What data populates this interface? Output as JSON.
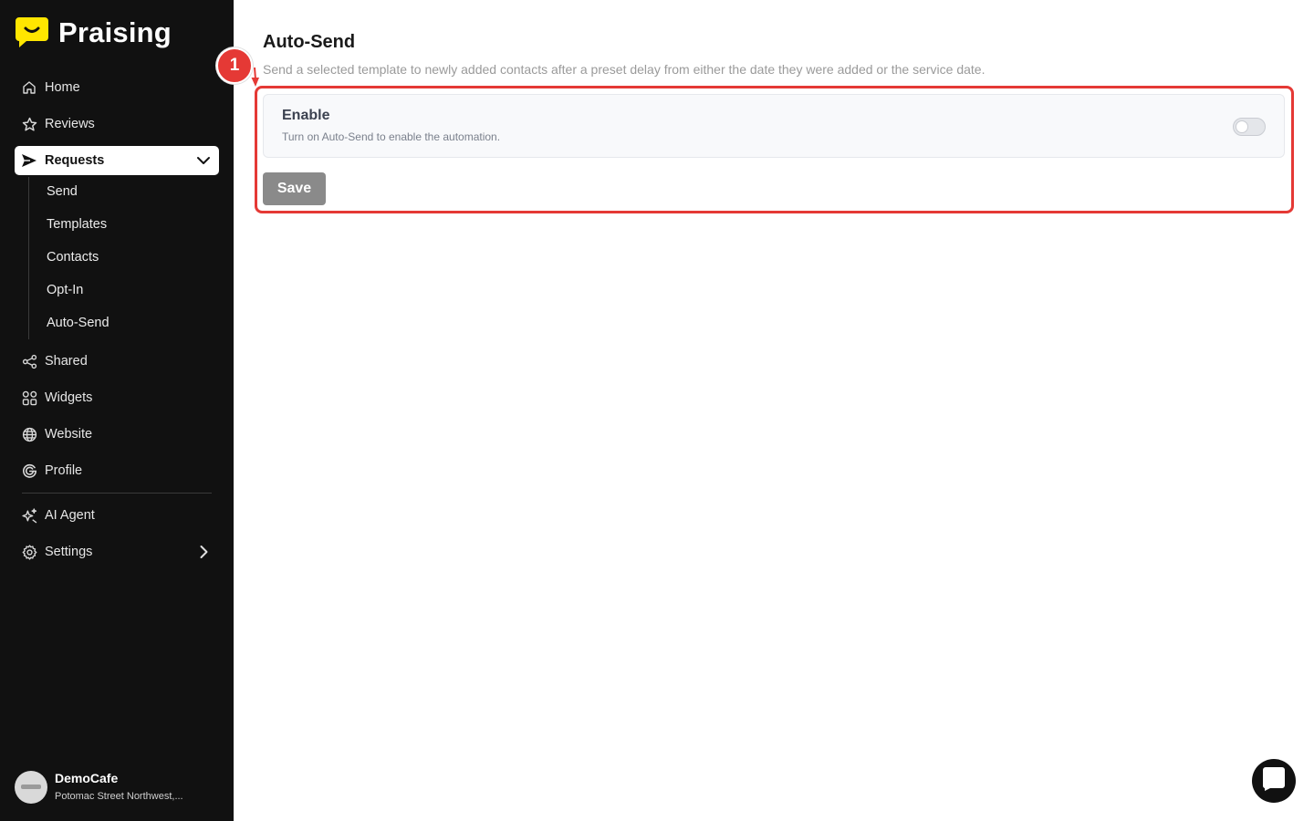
{
  "brand": {
    "name": "Praising",
    "accent": "#FFE600"
  },
  "sidebar": {
    "items": [
      {
        "id": "home",
        "label": "Home",
        "icon": "home-icon"
      },
      {
        "id": "reviews",
        "label": "Reviews",
        "icon": "star-icon"
      },
      {
        "id": "requests",
        "label": "Requests",
        "icon": "send-icon",
        "active": true,
        "expanded": true
      },
      {
        "id": "shared",
        "label": "Shared",
        "icon": "share-icon"
      },
      {
        "id": "widgets",
        "label": "Widgets",
        "icon": "widgets-icon"
      },
      {
        "id": "website",
        "label": "Website",
        "icon": "globe-icon"
      },
      {
        "id": "profile",
        "label": "Profile",
        "icon": "google-icon"
      },
      {
        "id": "ai-agent",
        "label": "AI Agent",
        "icon": "sparkle-icon"
      },
      {
        "id": "settings",
        "label": "Settings",
        "icon": "gear-icon"
      }
    ],
    "requests_sub": [
      "Send",
      "Templates",
      "Contacts",
      "Opt-In",
      "Auto-Send"
    ]
  },
  "account": {
    "name": "DemoCafe",
    "address": "Potomac Street Northwest,..."
  },
  "main": {
    "title": "Auto-Send",
    "description": "Send a selected template to newly added contacts after a preset delay from either the date they were added or the service date.",
    "enable_card": {
      "title": "Enable",
      "subtitle": "Turn on Auto-Send to enable the automation.",
      "toggle_on": false
    },
    "save_label": "Save"
  },
  "annotation": {
    "step": "1",
    "color": "#E53935"
  }
}
